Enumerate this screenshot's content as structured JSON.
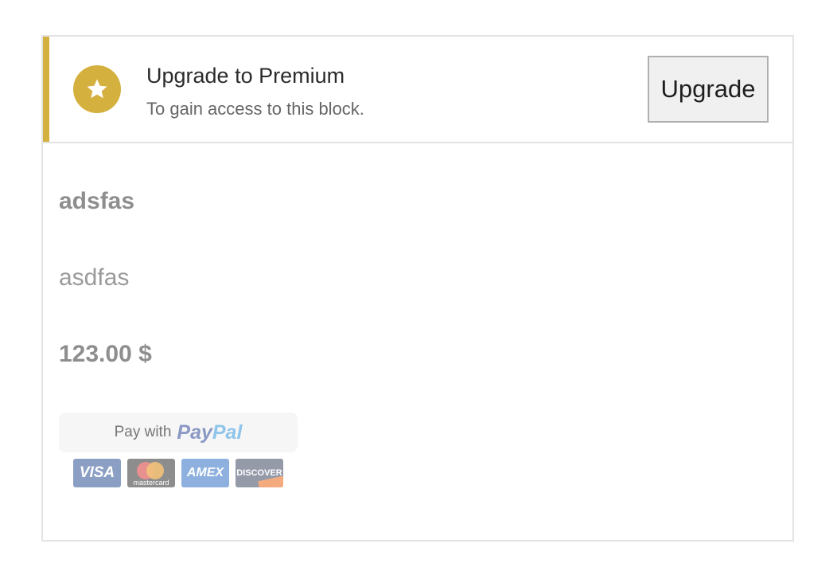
{
  "banner": {
    "icon": "star-icon",
    "title": "Upgrade to Premium",
    "subtitle": "To gain access to this block.",
    "button_label": "Upgrade",
    "accent_color": "#d4b03e"
  },
  "product": {
    "title": "adsfas",
    "description": "asdfas",
    "price": "123.00 $"
  },
  "payment": {
    "prefix": "Pay with",
    "logo_pay": "Pay",
    "logo_pal": "Pal",
    "cards": {
      "visa": "VISA",
      "mastercard": "mastercard",
      "amex": "AMEX",
      "discover": "DISCOVER"
    }
  }
}
